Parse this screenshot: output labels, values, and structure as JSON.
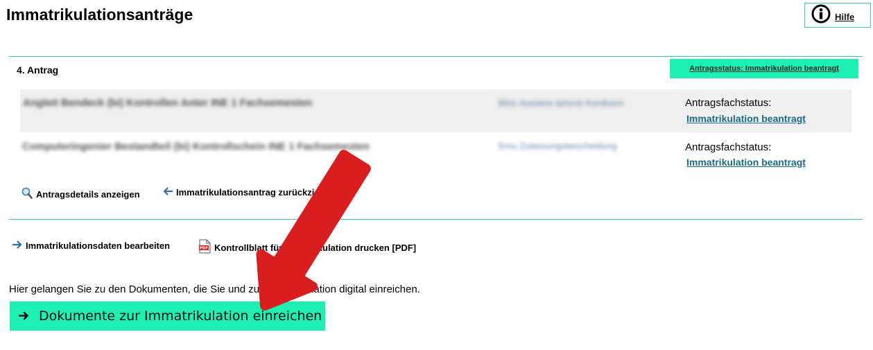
{
  "page": {
    "title": "Immatrikulationsanträge"
  },
  "help": {
    "label": "Hilfe",
    "icon": "info-circle-icon"
  },
  "antrag": {
    "title": "4. Antrag",
    "status_badge": "Antragsstatus: Immatrikulation beantragt",
    "rows": [
      {
        "program_blurred": "Angleit Bendeck (bi) Kontrollen Anter INE 1 Fachsemesten",
        "detail_blurred": "Bilsc Ausweis Iphone Kontkann",
        "fach_label": "Antragsfachstatus:",
        "fach_status": "Immatrikulation beantragt"
      },
      {
        "program_blurred": "Computeringenier Bestandteil (bi) Kontrollschein INE 1 Fachsemesten",
        "detail_blurred": "Emu Zulassungsbescheidung",
        "fach_label": "Antragsfachstatus:",
        "fach_status": "Immatrikulation beantragt"
      }
    ]
  },
  "actions": {
    "details": "Antragsdetails anzeigen",
    "withdraw": "Immatrikulationsantrag zurückziehen",
    "edit": "Immatrikulationsdaten bearbeiten",
    "print_pdf": "Kontrollblatt für Immatrikulation drucken [PDF]"
  },
  "info_text": "Hier gelangen Sie zu den Dokumenten, die Sie und zur Immatrikulation digital einreichen.",
  "primary_button": {
    "label": "Dokumente zur Immatrikulation einreichen"
  },
  "colors": {
    "accent": "#1ef0b4",
    "rule": "#2dd4ad",
    "link": "#1a6b86",
    "annotation_arrow": "#d81e1e"
  }
}
